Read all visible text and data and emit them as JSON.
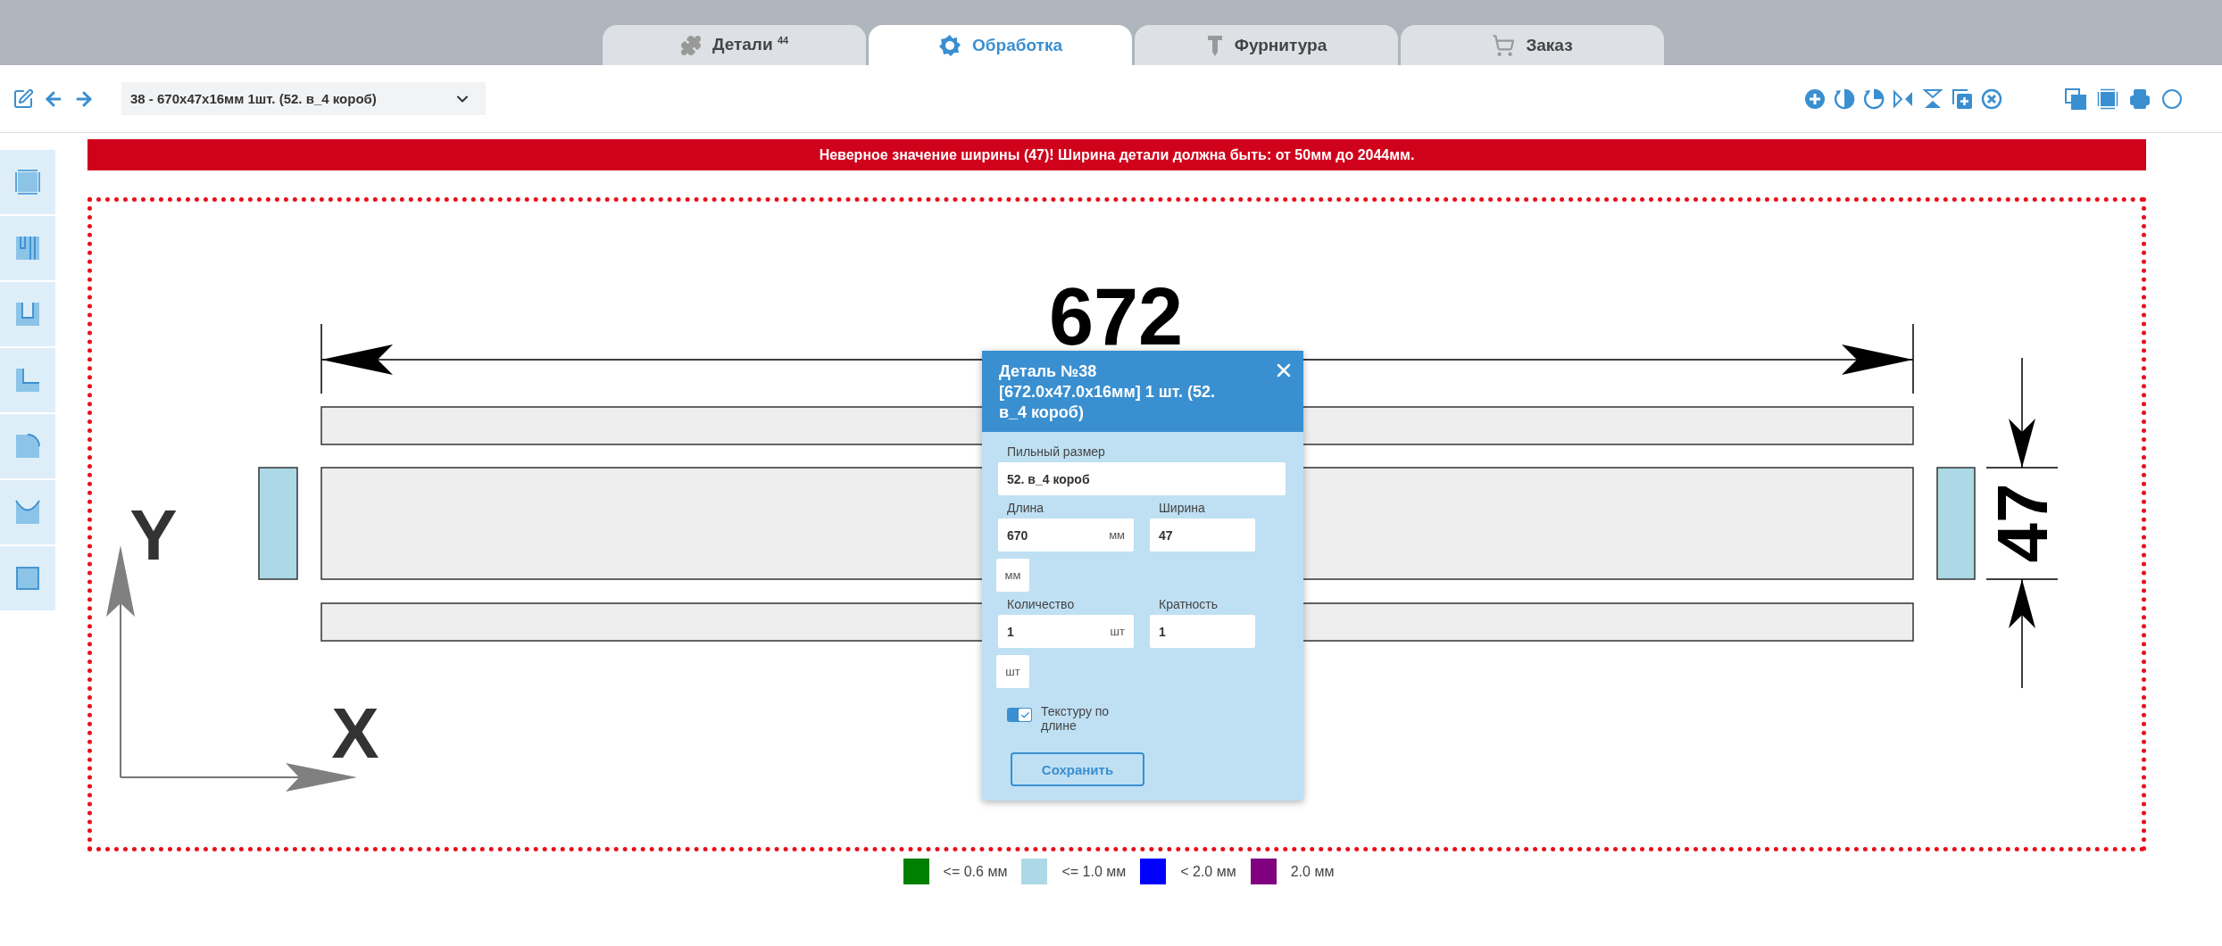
{
  "tabs": [
    {
      "label": "Детали $^{44}$",
      "selected": false
    },
    {
      "label": "Обработка",
      "selected": true
    },
    {
      "label": "Фурнитура",
      "selected": false
    },
    {
      "label": "Заказ",
      "selected": false
    }
  ],
  "toolbar": {
    "detail_select": "38 - 670x47x16мм 1шт. (52. в_4 короб)"
  },
  "error_banner": "Неверное значение ширины (47)! Ширина детали должна быть: от 50мм до 2044мм.",
  "drawing": {
    "length_label": "672",
    "width_label": "47",
    "axis_x": "X",
    "axis_y": "Y"
  },
  "dialog": {
    "title": "Деталь №38 [672.0x47.0x16мм] 1 шт. (52. в_4 короб)",
    "wide_field": {
      "label": "Пильный размер",
      "value": "52. в_4 короб"
    },
    "pairs": [
      {
        "left": {
          "label": "Длина",
          "value": "670",
          "unit": "мм"
        },
        "right": {
          "label": "Ширина",
          "value": "47"
        },
        "extra_unit": "мм"
      },
      {
        "left": {
          "label": "Количество",
          "value": "1",
          "unit": "шт"
        },
        "right": {
          "label": "Кратность",
          "value": "1"
        },
        "extra_unit": "шт"
      }
    ],
    "texture_toggle": {
      "label": "Текстуру по длине",
      "on": true
    },
    "save_button": "Сохранить"
  },
  "legend": [
    {
      "label": "<= 0.6 мм",
      "color": "#008000"
    },
    {
      "label": "<= 1.0 мм",
      "color": "#add8e6"
    },
    {
      "label": "< 2.0 мм",
      "color": "#0000ff"
    },
    {
      "label": "2.0 мм",
      "color": "#800080"
    }
  ]
}
